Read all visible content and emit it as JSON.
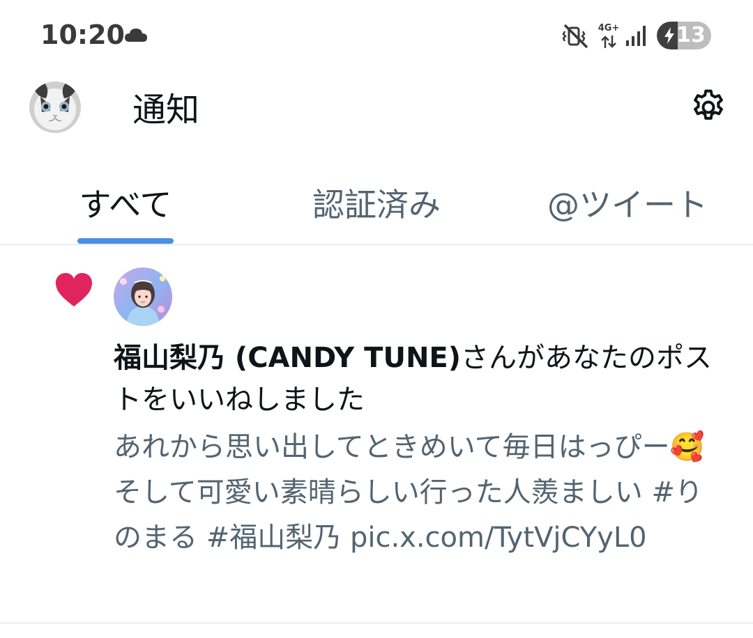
{
  "status_bar": {
    "time": "10:20",
    "network_type": "4G+",
    "battery_level": "13",
    "battery_fraction": 0.13,
    "icons": [
      "cloud-icon",
      "vibrate-mute-icon",
      "data-arrows-icon",
      "signal-icon",
      "battery-charging-icon"
    ]
  },
  "header": {
    "title": "通知",
    "avatar_icon": "cat-avatar",
    "settings_icon": "gear-icon"
  },
  "tabs": {
    "items": [
      {
        "label": "すべて",
        "selected": true
      },
      {
        "label": "認証済み",
        "selected": false
      },
      {
        "label": "@ツイート",
        "selected": false
      }
    ],
    "indicator_color": "#4a90e2"
  },
  "notification": {
    "type_icon": "heart-icon",
    "type_color": "#e0245e",
    "user_name": "福山梨乃 (CANDY TUNE)",
    "action_text": "さんがあなたのポストをいいねしました",
    "preview_text": "あれから思い出してときめいて毎日はっぴー🥰そして可愛い素晴らしい行った人羨ましい #りのまる  #福山梨乃 pic.x.com/TytVjCYyL0"
  },
  "colors": {
    "text_primary": "#0f1419",
    "text_secondary": "#536471",
    "divider": "#d8dde1"
  }
}
